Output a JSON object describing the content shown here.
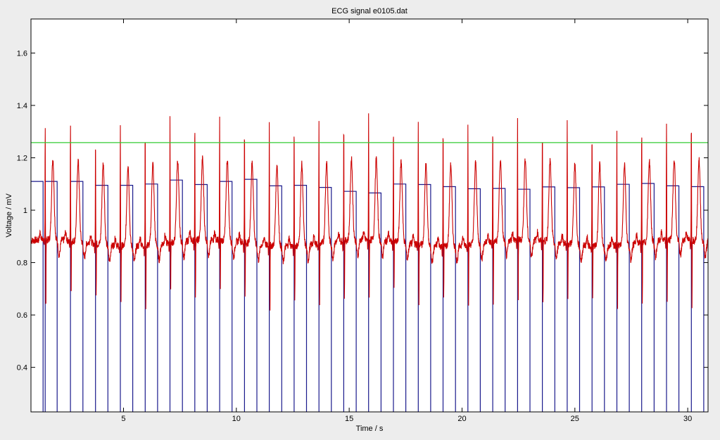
{
  "chart_data": {
    "type": "line",
    "title": "ECG signal e0105.dat",
    "xlabel": "Time / s",
    "ylabel": "Voltage / mV",
    "xlim": [
      0.9,
      30.9
    ],
    "ylim": [
      0.23,
      1.73
    ],
    "xticks": [
      5,
      10,
      15,
      20,
      25,
      30
    ],
    "yticks": [
      0.4,
      0.6,
      0.8,
      1.0,
      1.2,
      1.4,
      1.6
    ],
    "ytick_labels": [
      "0.4",
      "0.6",
      "0.8",
      "1",
      "1.2",
      "1.4",
      "1.6"
    ],
    "grid": false,
    "colors": {
      "ecg": "#cc0000",
      "detection": "#1a1a8c",
      "threshold": "#33cc33",
      "background": "#ededed",
      "plot_area": "#ffffff"
    },
    "threshold": 1.258,
    "beats": [
      {
        "t": 1.53,
        "r": 1.34,
        "s": 0.61,
        "width": 0.53,
        "height": 1.11
      },
      {
        "t": 2.65,
        "r": 1.36,
        "s": 0.68,
        "width": 0.55,
        "height": 1.11
      },
      {
        "t": 3.76,
        "r": 1.33,
        "s": 0.7,
        "width": 0.55,
        "height": 1.095
      },
      {
        "t": 4.86,
        "r": 1.37,
        "s": 0.68,
        "width": 0.55,
        "height": 1.095
      },
      {
        "t": 5.96,
        "r": 1.35,
        "s": 0.63,
        "width": 0.55,
        "height": 1.1
      },
      {
        "t": 7.06,
        "r": 1.37,
        "s": 0.72,
        "width": 0.55,
        "height": 1.115
      },
      {
        "t": 8.16,
        "r": 1.37,
        "s": 0.68,
        "width": 0.55,
        "height": 1.098
      },
      {
        "t": 9.26,
        "r": 1.37,
        "s": 0.7,
        "width": 0.55,
        "height": 1.11
      },
      {
        "t": 10.36,
        "r": 1.37,
        "s": 0.68,
        "width": 0.55,
        "height": 1.118
      },
      {
        "t": 11.46,
        "r": 1.38,
        "s": 0.65,
        "width": 0.55,
        "height": 1.093
      },
      {
        "t": 12.56,
        "r": 1.38,
        "s": 0.68,
        "width": 0.55,
        "height": 1.095
      },
      {
        "t": 13.66,
        "r": 1.37,
        "s": 0.66,
        "width": 0.55,
        "height": 1.087
      },
      {
        "t": 14.76,
        "r": 1.39,
        "s": 0.66,
        "width": 0.55,
        "height": 1.072
      },
      {
        "t": 15.86,
        "r": 1.38,
        "s": 0.68,
        "width": 0.55,
        "height": 1.066
      },
      {
        "t": 16.96,
        "r": 1.37,
        "s": 0.7,
        "width": 0.55,
        "height": 1.1
      },
      {
        "t": 18.06,
        "r": 1.38,
        "s": 0.67,
        "width": 0.55,
        "height": 1.098
      },
      {
        "t": 19.16,
        "r": 1.37,
        "s": 0.69,
        "width": 0.55,
        "height": 1.09
      },
      {
        "t": 20.26,
        "r": 1.37,
        "s": 0.67,
        "width": 0.55,
        "height": 1.082
      },
      {
        "t": 21.36,
        "r": 1.36,
        "s": 0.66,
        "width": 0.55,
        "height": 1.083
      },
      {
        "t": 22.46,
        "r": 1.36,
        "s": 0.66,
        "width": 0.55,
        "height": 1.08
      },
      {
        "t": 23.56,
        "r": 1.35,
        "s": 0.64,
        "width": 0.55,
        "height": 1.089
      },
      {
        "t": 24.66,
        "r": 1.37,
        "s": 0.67,
        "width": 0.55,
        "height": 1.086
      },
      {
        "t": 25.76,
        "r": 1.35,
        "s": 0.68,
        "width": 0.55,
        "height": 1.089
      },
      {
        "t": 26.86,
        "r": 1.34,
        "s": 0.66,
        "width": 0.55,
        "height": 1.099
      },
      {
        "t": 27.96,
        "r": 1.36,
        "s": 0.65,
        "width": 0.55,
        "height": 1.102
      },
      {
        "t": 29.06,
        "r": 1.35,
        "s": 0.66,
        "width": 0.55,
        "height": 1.093
      },
      {
        "t": 30.16,
        "r": 1.38,
        "s": 0.64,
        "width": 0.55,
        "height": 1.09
      }
    ]
  }
}
